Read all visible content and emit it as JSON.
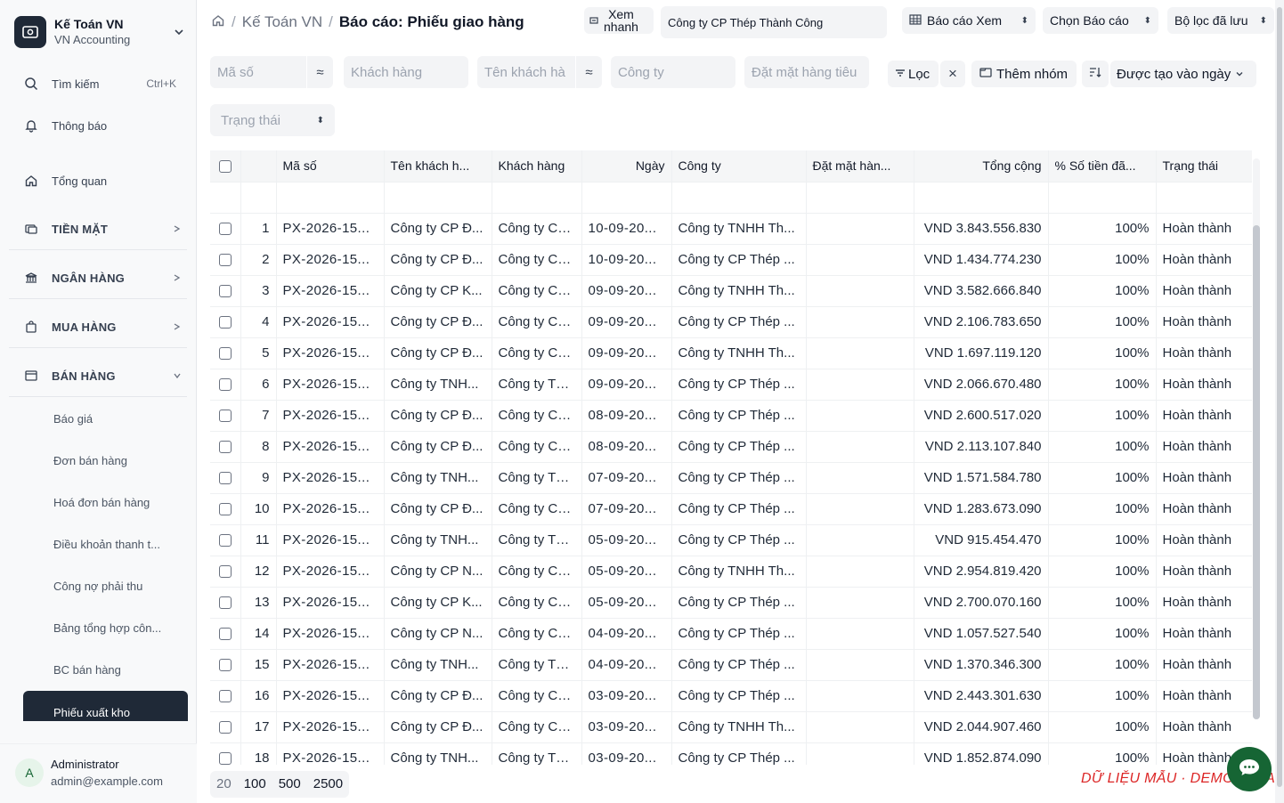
{
  "brand": {
    "title": "Kế Toán VN",
    "subtitle": "VN Accounting"
  },
  "nav": {
    "search_label": "Tìm kiếm",
    "search_shortcut": "Ctrl+K",
    "notifications_label": "Thông báo",
    "overview_label": "Tổng quan",
    "sections": {
      "cash": "TIỀN MẶT",
      "bank": "NGÂN HÀNG",
      "purchasing": "MUA HÀNG",
      "sales": "BÁN HÀNG"
    },
    "sales_items": [
      "Báo giá",
      "Đơn bán hàng",
      "Hoá đơn bán hàng",
      "Điều khoản thanh t...",
      "Công nợ phải thu",
      "Bảng tổng hợp côn...",
      "BC bán hàng"
    ],
    "active_item": "Phiếu xuất kho"
  },
  "user": {
    "initial": "A",
    "name": "Administrator",
    "email": "admin@example.com"
  },
  "topbar": {
    "breadcrumb": [
      "Kế Toán VN",
      "Báo cáo: Phiếu giao hàng"
    ],
    "quick_view_line1": "Xem",
    "quick_view_line2": "nhanh",
    "company_value": "Công ty CP Thép Thành Công",
    "report_view": "Báo cáo Xem",
    "choose_report": "Chọn Báo cáo",
    "saved_filters": "Bộ lọc đã lưu"
  },
  "filters": {
    "code_placeholder": "Mã số",
    "customer_placeholder": "Khách hàng",
    "customer_name_placeholder": "Tên khách hà",
    "company_placeholder": "Công ty",
    "item_placeholder": "Đặt mặt hàng tiêu",
    "status_placeholder": "Trạng thái",
    "op_symbol": "≈",
    "filter_label": "Lọc",
    "clear_label": "×",
    "add_group_label": "Thêm nhóm",
    "sort_label": "Được tạo vào ngày"
  },
  "table": {
    "columns": [
      "Mã số",
      "Tên khách h...",
      "Khách hàng",
      "Ngày",
      "Công ty",
      "Đặt mặt hàn...",
      "Tổng cộng",
      "% Số tiền đã...",
      "Trạng thái"
    ],
    "rows": [
      {
        "n": "1",
        "code": "PX-2026-15...",
        "cust_name": "Công ty CP Đ...",
        "cust": "Công ty CP Đ...",
        "date": "10-09-20...",
        "company": "Công ty TNHH Th...",
        "item": "",
        "total": "VND 3.843.556.830",
        "pct": "100%",
        "status": "Hoàn thành"
      },
      {
        "n": "2",
        "code": "PX-2026-15...",
        "cust_name": "Công ty CP Đ...",
        "cust": "Công ty CP Đ...",
        "date": "10-09-20...",
        "company": "Công ty CP Thép ...",
        "item": "",
        "total": "VND 1.434.774.230",
        "pct": "100%",
        "status": "Hoàn thành"
      },
      {
        "n": "3",
        "code": "PX-2026-15...",
        "cust_name": "Công ty CP K...",
        "cust": "Công ty CP K...",
        "date": "09-09-20...",
        "company": "Công ty TNHH Th...",
        "item": "",
        "total": "VND 3.582.666.840",
        "pct": "100%",
        "status": "Hoàn thành"
      },
      {
        "n": "4",
        "code": "PX-2026-15...",
        "cust_name": "Công ty CP Đ...",
        "cust": "Công ty CP Đ...",
        "date": "09-09-20...",
        "company": "Công ty CP Thép ...",
        "item": "",
        "total": "VND 2.106.783.650",
        "pct": "100%",
        "status": "Hoàn thành"
      },
      {
        "n": "5",
        "code": "PX-2026-15...",
        "cust_name": "Công ty CP Đ...",
        "cust": "Công ty CP Đ...",
        "date": "09-09-20...",
        "company": "Công ty TNHH Th...",
        "item": "",
        "total": "VND 1.697.119.120",
        "pct": "100%",
        "status": "Hoàn thành"
      },
      {
        "n": "6",
        "code": "PX-2026-15...",
        "cust_name": "Công ty TNH...",
        "cust": "Công ty TNH...",
        "date": "09-09-20...",
        "company": "Công ty CP Thép ...",
        "item": "",
        "total": "VND 2.066.670.480",
        "pct": "100%",
        "status": "Hoàn thành"
      },
      {
        "n": "7",
        "code": "PX-2026-15...",
        "cust_name": "Công ty CP Đ...",
        "cust": "Công ty CP Đ...",
        "date": "08-09-20...",
        "company": "Công ty CP Thép ...",
        "item": "",
        "total": "VND 2.600.517.020",
        "pct": "100%",
        "status": "Hoàn thành"
      },
      {
        "n": "8",
        "code": "PX-2026-15...",
        "cust_name": "Công ty CP Đ...",
        "cust": "Công ty CP Đ...",
        "date": "08-09-20...",
        "company": "Công ty CP Thép ...",
        "item": "",
        "total": "VND 2.113.107.840",
        "pct": "100%",
        "status": "Hoàn thành"
      },
      {
        "n": "9",
        "code": "PX-2026-15...",
        "cust_name": "Công ty TNH...",
        "cust": "Công ty TNH...",
        "date": "07-09-20...",
        "company": "Công ty CP Thép ...",
        "item": "",
        "total": "VND 1.571.584.780",
        "pct": "100%",
        "status": "Hoàn thành"
      },
      {
        "n": "10",
        "code": "PX-2026-15...",
        "cust_name": "Công ty CP Đ...",
        "cust": "Công ty CP Đ...",
        "date": "07-09-20...",
        "company": "Công ty CP Thép ...",
        "item": "",
        "total": "VND 1.283.673.090",
        "pct": "100%",
        "status": "Hoàn thành"
      },
      {
        "n": "11",
        "code": "PX-2026-15...",
        "cust_name": "Công ty TNH...",
        "cust": "Công ty TNH...",
        "date": "05-09-20...",
        "company": "Công ty CP Thép ...",
        "item": "",
        "total": "VND 915.454.470",
        "pct": "100%",
        "status": "Hoàn thành"
      },
      {
        "n": "12",
        "code": "PX-2026-15...",
        "cust_name": "Công ty CP N...",
        "cust": "Công ty CP N...",
        "date": "05-09-20...",
        "company": "Công ty TNHH Th...",
        "item": "",
        "total": "VND 2.954.819.420",
        "pct": "100%",
        "status": "Hoàn thành"
      },
      {
        "n": "13",
        "code": "PX-2026-15...",
        "cust_name": "Công ty CP K...",
        "cust": "Công ty CP K...",
        "date": "05-09-20...",
        "company": "Công ty CP Thép ...",
        "item": "",
        "total": "VND 2.700.070.160",
        "pct": "100%",
        "status": "Hoàn thành"
      },
      {
        "n": "14",
        "code": "PX-2026-15...",
        "cust_name": "Công ty CP N...",
        "cust": "Công ty CP N...",
        "date": "04-09-20...",
        "company": "Công ty CP Thép ...",
        "item": "",
        "total": "VND 1.057.527.540",
        "pct": "100%",
        "status": "Hoàn thành"
      },
      {
        "n": "15",
        "code": "PX-2026-15...",
        "cust_name": "Công ty TNH...",
        "cust": "Công ty TNH...",
        "date": "04-09-20...",
        "company": "Công ty CP Thép ...",
        "item": "",
        "total": "VND 1.370.346.300",
        "pct": "100%",
        "status": "Hoàn thành"
      },
      {
        "n": "16",
        "code": "PX-2026-15...",
        "cust_name": "Công ty CP Đ...",
        "cust": "Công ty CP Đ...",
        "date": "03-09-20...",
        "company": "Công ty CP Thép ...",
        "item": "",
        "total": "VND 2.443.301.630",
        "pct": "100%",
        "status": "Hoàn thành"
      },
      {
        "n": "17",
        "code": "PX-2026-15...",
        "cust_name": "Công ty CP Đ...",
        "cust": "Công ty CP Đ...",
        "date": "03-09-20...",
        "company": "Công ty TNHH Th...",
        "item": "",
        "total": "VND 2.044.907.460",
        "pct": "100%",
        "status": "Hoàn thành"
      },
      {
        "n": "18",
        "code": "PX-2026-15...",
        "cust_name": "Công ty TNH...",
        "cust": "Công ty TNH...",
        "date": "03-09-20...",
        "company": "Công ty CP Thép ...",
        "item": "",
        "total": "VND 1.852.874.090",
        "pct": "100%",
        "status": "Hoàn thành"
      }
    ]
  },
  "paging": {
    "sizes": [
      "20",
      "100",
      "500",
      "2500"
    ]
  },
  "demo_label": "DỮ LIỆU MẪU · DEMO DATA",
  "colors": {
    "sidebar_active": "#1f2937",
    "demo_red": "#dc2626",
    "chat_green": "#166534"
  }
}
